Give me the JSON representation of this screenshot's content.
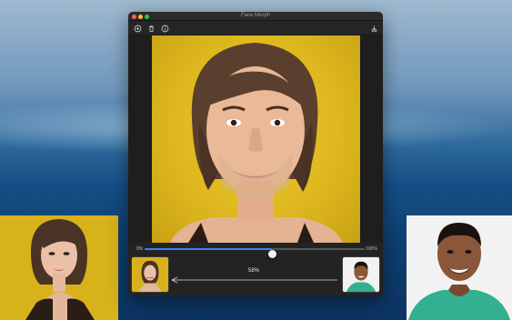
{
  "window": {
    "title": "Face Morph"
  },
  "toolbar": {
    "add_icon": "add-circle-icon",
    "delete_icon": "trash-icon",
    "info_icon": "info-icon",
    "export_icon": "export-icon"
  },
  "slider": {
    "min_label": "0%",
    "max_label": "100%",
    "value_label": "58%",
    "value": 0.58,
    "accent_color": "#3b82f6"
  },
  "colors": {
    "canvas_background": "#dcb51a",
    "window_background": "#1e1e1e"
  }
}
